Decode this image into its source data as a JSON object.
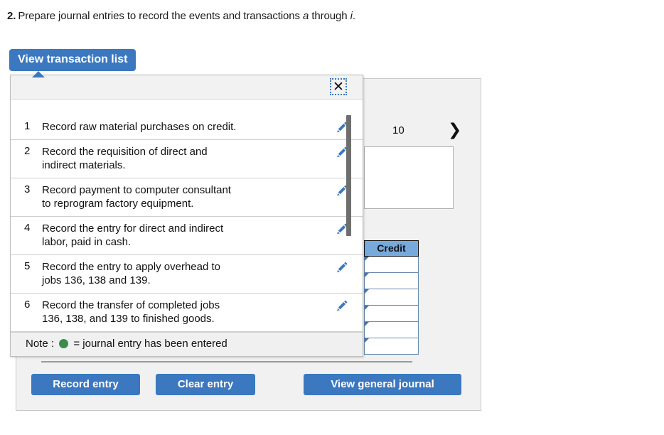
{
  "question": {
    "number": "2.",
    "text_before_a": "Prepare journal entries to record the events and transactions ",
    "italic_a": "a",
    "text_middle": " through ",
    "italic_i": "i",
    "text_end": "."
  },
  "tab": {
    "label": "View transaction list"
  },
  "popup": {
    "close_label": "✕",
    "close_icon": "close-icon",
    "transactions": [
      {
        "number": "1",
        "description": "Record raw material purchases on credit.",
        "edit_icon": "pencil-icon"
      },
      {
        "number": "2",
        "description": "Record the requisition of direct and\nindirect materials.",
        "edit_icon": "pencil-icon"
      },
      {
        "number": "3",
        "description": "Record payment to computer consultant\nto reprogram factory equipment.",
        "edit_icon": "pencil-icon"
      },
      {
        "number": "4",
        "description": "Record the entry for direct and indirect\nlabor, paid in cash.",
        "edit_icon": "pencil-icon"
      },
      {
        "number": "5",
        "description": "Record the entry to apply overhead to\njobs 136, 138 and 139.",
        "edit_icon": "pencil-icon"
      },
      {
        "number": "6",
        "description": "Record the transfer of completed jobs\n136, 138, and 139 to finished goods.",
        "edit_icon": "pencil-icon"
      }
    ],
    "note_prefix": "Note : ",
    "note_suffix": " = journal entry has been entered",
    "note_dot_color": "#3f8a4b"
  },
  "journal_form": {
    "pagination": {
      "prev_label": "⟨",
      "page_label": "10",
      "next_label": "❯"
    },
    "credit_header": "Credit",
    "credit_rows": [
      "",
      "",
      "",
      "",
      "",
      ""
    ]
  },
  "buttons": {
    "record_entry": "Record entry",
    "clear_entry": "Clear entry",
    "view_general_journal": "View general journal"
  },
  "colors": {
    "accent_blue": "#3b78bf",
    "credit_header_blue": "#77a9dd",
    "panel_grey": "#f1f1f1",
    "note_green": "#3f8a4b"
  }
}
